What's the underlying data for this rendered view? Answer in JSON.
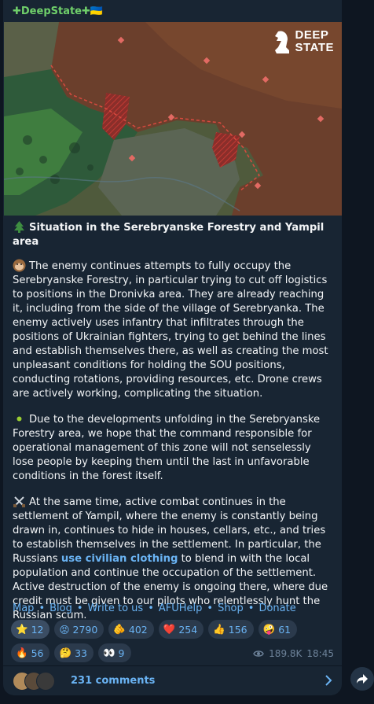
{
  "channel": {
    "name": "✚DeepState✚🇺🇦"
  },
  "map_logo": {
    "line1": "DEEP",
    "line2": "STATE"
  },
  "post": {
    "headline": "Situation in the Serebryanske Forestry and Yampil area",
    "para1": "The enemy continues attempts to fully occupy the Serebryanske Forestry, in particular trying to cut off logistics to positions in the Dronivka area. They are already reaching it, including from the side of the village of Serebryanka. The enemy actively uses infantry that infiltrates through the positions of Ukrainian fighters, trying to get behind the lines and establish themselves there, as well as creating the most unpleasant conditions for holding the SOU positions, conducting rotations, providing resources, etc. Drone crews are actively working, complicating the situation.",
    "para2": "Due to the developments unfolding in the Serebryanske Forestry area, we hope that the command responsible for operational management of this zone will not senselessly lose people by keeping them until the last in unfavorable conditions in the forest itself.",
    "para3_before": "At the same time, active combat continues in the settlement of Yampil, where the enemy is constantly being drawn in, continues to hide in houses, cellars, etc., and tries to establish themselves in the settlement. In particular, the Russians ",
    "para3_link": "use civilian clothing",
    "para3_after": " to blend in with the local population and continue the occupation of the settlement. Active destruction of the enemy is ongoing there, where due credit must be given to our pilots who relentlessly hunt the Russian scum."
  },
  "footer_links": [
    "Map",
    "Blog",
    "Write to us",
    "AFUHelp",
    "Shop",
    "Donate"
  ],
  "reactions": [
    {
      "icon": "star-icon",
      "emoji": "⭐",
      "count": "12"
    },
    {
      "icon": "angry-face-icon",
      "emoji": "😡",
      "count": "2790"
    },
    {
      "icon": "pointing-hand-icon",
      "emoji": "🫵",
      "count": "402"
    },
    {
      "icon": "heart-icon",
      "emoji": "❤️",
      "count": "254"
    },
    {
      "icon": "thumbs-up-icon",
      "emoji": "👍",
      "count": "156"
    },
    {
      "icon": "zany-face-icon",
      "emoji": "🤪",
      "count": "61"
    },
    {
      "icon": "fire-icon",
      "emoji": "🔥",
      "count": "56"
    },
    {
      "icon": "thinking-face-icon",
      "emoji": "🤔",
      "count": "33"
    },
    {
      "icon": "eyes-icon",
      "emoji": "👀",
      "count": "9"
    }
  ],
  "meta": {
    "views": "189.8K",
    "time": "18:45"
  },
  "comments": {
    "label": "231 comments"
  }
}
